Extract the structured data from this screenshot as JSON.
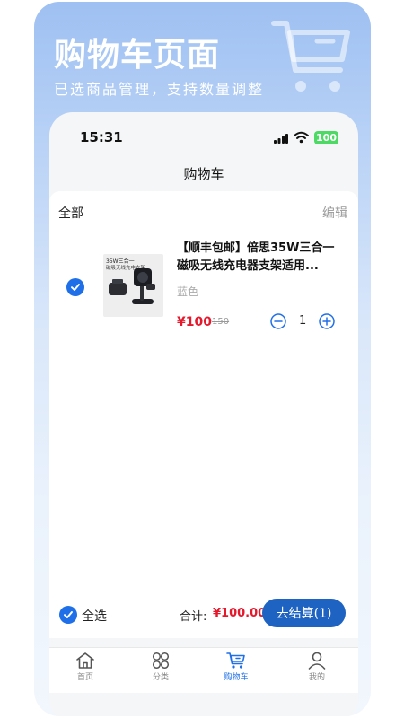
{
  "hero": {
    "title": "购物车页面",
    "subtitle": "已选商品管理，支持数量调整",
    "deco_icon": "shopping-cart-icon"
  },
  "status_bar": {
    "time": "15:31",
    "battery": "100"
  },
  "header": {
    "title": "购物车"
  },
  "cart": {
    "select_all_top": "全部",
    "edit": "编辑",
    "items": [
      {
        "thumb_text_1": "35W三合一",
        "thumb_text_2": "磁吸无线充电支架",
        "title": "【顺丰包邮】倍思35W三合一磁吸无线充电器支架适用...",
        "spec": "蓝色",
        "price": "¥100",
        "original_price": "150",
        "quantity": "1",
        "checked": true
      }
    ]
  },
  "footer": {
    "select_all": "全选",
    "total_label": "合计:",
    "total_value": "¥100.00",
    "checkout": "去结算(1)"
  },
  "tabs": [
    {
      "label": "首页",
      "icon": "home-icon"
    },
    {
      "label": "分类",
      "icon": "category-icon"
    },
    {
      "label": "购物车",
      "icon": "cart-icon",
      "active": true
    },
    {
      "label": "我的",
      "icon": "user-icon"
    }
  ],
  "colors": {
    "accent": "#1e6fe8",
    "price": "#e6182c",
    "button": "#1e63c2"
  }
}
